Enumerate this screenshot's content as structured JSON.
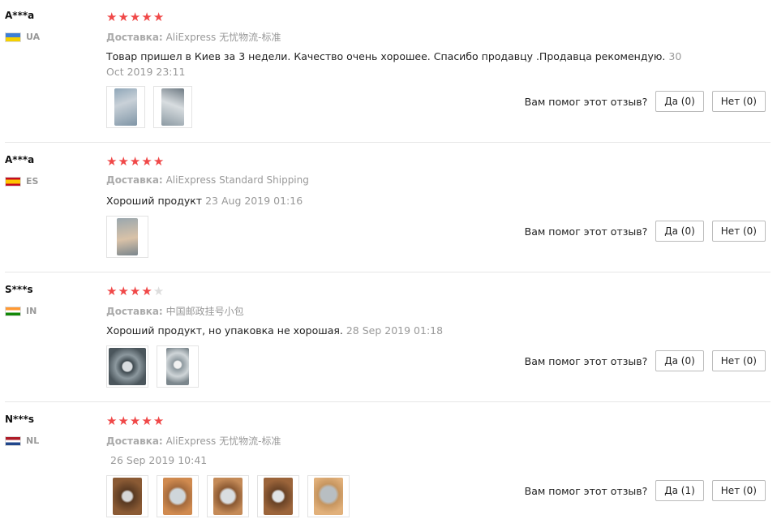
{
  "ship_label": "Доставка:",
  "helpful_question": "Вам помог этот отзыв?",
  "accent_color": "#f04848",
  "reviews": [
    {
      "user": "A***a",
      "country": "UA",
      "flag_colors": [
        "#3d7fd6",
        "#f5d000"
      ],
      "rating": 5,
      "shipping": "AliExpress 无忧物流-标准",
      "text": "Товар пришел в Киев за 3 недели. Качество очень хорошее. Спасибо продавцу .Продавца рекомендую.",
      "date": "30 Oct 2019 23:11",
      "photo_count": 2,
      "yes_label": "Да (0)",
      "no_label": "Нет (0)"
    },
    {
      "user": "A***a",
      "country": "ES",
      "flag_colors": [
        "#c60b1e",
        "#ffc400"
      ],
      "rating": 5,
      "shipping": "AliExpress Standard Shipping",
      "text": "Хороший продукт",
      "date": "23 Aug 2019 01:16",
      "photo_count": 1,
      "yes_label": "Да (0)",
      "no_label": "Нет (0)"
    },
    {
      "user": "S***s",
      "country": "IN",
      "flag_colors": [
        "#ff9933",
        "#ffffff",
        "#138808"
      ],
      "rating": 4,
      "shipping": "中国邮政挂号小包",
      "text": "Хороший продукт, но упаковка не хорошая.",
      "date": "28 Sep 2019 01:18",
      "photo_count": 2,
      "yes_label": "Да (0)",
      "no_label": "Нет (0)"
    },
    {
      "user": "N***s",
      "country": "NL",
      "flag_colors": [
        "#ae1c28",
        "#ffffff",
        "#21468b"
      ],
      "rating": 5,
      "shipping": "AliExpress 无忧物流-标准",
      "text": "",
      "date": "26 Sep 2019 10:41",
      "photo_count": 5,
      "yes_label": "Да (1)",
      "no_label": "Нет (0)"
    }
  ]
}
